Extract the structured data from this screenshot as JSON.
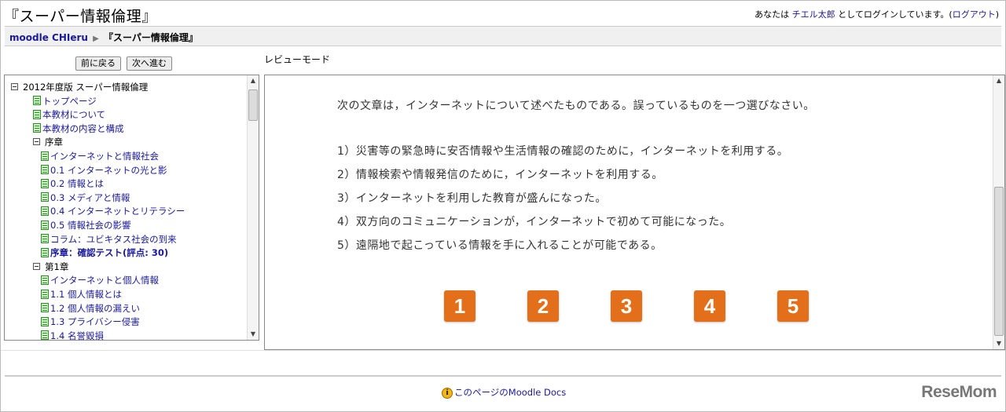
{
  "header": {
    "site_title": "『スーパー情報倫理』",
    "login_prefix": "あなたは ",
    "user_name": "チエル太郎",
    "login_suffix": " としてログインしています。(",
    "logout_label": "ログアウト",
    "login_close": ")"
  },
  "breadcrumb": {
    "home": "moodle CHIeru",
    "separator": "▶",
    "current": "『スーパー情報倫理』"
  },
  "nav": {
    "prev_label": "前に戻る",
    "next_label": "次へ進む",
    "mode_label": "レビューモード"
  },
  "toc": {
    "items": [
      {
        "label": "2012年度版 スーパー情報倫理",
        "kind": "section",
        "level": 0
      },
      {
        "label": "トップページ",
        "kind": "link",
        "level": 1
      },
      {
        "label": "本教材について",
        "kind": "link",
        "level": 1
      },
      {
        "label": "本教材の内容と構成",
        "kind": "link",
        "level": 1
      },
      {
        "label": "序章",
        "kind": "section",
        "level": 1
      },
      {
        "label": "インターネットと情報社会",
        "kind": "link",
        "level": 2
      },
      {
        "label": "0.1 インターネットの光と影",
        "kind": "link",
        "level": 2
      },
      {
        "label": "0.2 情報とは",
        "kind": "link",
        "level": 2
      },
      {
        "label": "0.3 メディアと情報",
        "kind": "link",
        "level": 2
      },
      {
        "label": "0.4 インターネットとリテラシー",
        "kind": "link",
        "level": 2
      },
      {
        "label": "0.5 情報社会の影響",
        "kind": "link",
        "level": 2
      },
      {
        "label": "コラム：ユビキタス社会の到来",
        "kind": "link",
        "level": 2
      },
      {
        "label": "序章：確認テスト(評点: 30)",
        "kind": "link-bold",
        "level": 2
      },
      {
        "label": "第1章",
        "kind": "section",
        "level": 1
      },
      {
        "label": "インターネットと個人情報",
        "kind": "link",
        "level": 2
      },
      {
        "label": "1.1 個人情報とは",
        "kind": "link",
        "level": 2
      },
      {
        "label": "1.2 個人情報の漏えい",
        "kind": "link",
        "level": 2
      },
      {
        "label": "1.3 プライバシー侵害",
        "kind": "link",
        "level": 2
      },
      {
        "label": "1.4 名誉毀損",
        "kind": "link",
        "level": 2
      }
    ]
  },
  "quiz": {
    "question": "次の文章は，インターネットについて述べたものである。誤っているものを一つ選びなさい。",
    "choices": [
      "1）災害等の緊急時に安否情報や生活情報の確認のために，インターネットを利用する。",
      "2）情報検索や情報発信のために，インターネットを利用する。",
      "3）インターネットを利用した教育が盛んになった。",
      "4）双方向のコミュニケーションが，インターネットで初めて可能になった。",
      "5）遠隔地で起こっている情報を手に入れることが可能である。"
    ],
    "answer_buttons": [
      "1",
      "2",
      "3",
      "4",
      "5"
    ],
    "button_color": "#e46f1a"
  },
  "footer": {
    "info_icon_glyph": "i",
    "docs_link": "このページのMoodle Docs",
    "watermark": "ReseMom"
  }
}
